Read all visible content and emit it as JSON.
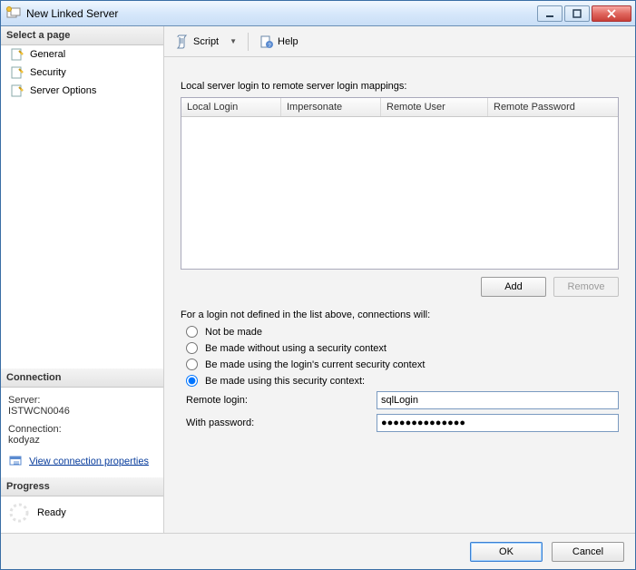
{
  "window": {
    "title": "New Linked Server"
  },
  "sidebar": {
    "select_page": "Select a page",
    "items": [
      {
        "label": "General"
      },
      {
        "label": "Security"
      },
      {
        "label": "Server Options"
      }
    ],
    "connection_header": "Connection",
    "server_label": "Server:",
    "server_value": "ISTWCN0046",
    "connection_label": "Connection:",
    "connection_value": "kodyaz",
    "view_props": "View connection properties",
    "progress_header": "Progress",
    "progress_status": "Ready"
  },
  "toolbar": {
    "script": "Script",
    "help": "Help"
  },
  "content": {
    "mapping_label": "Local server login to remote server login mappings:",
    "columns": {
      "local_login": "Local Login",
      "impersonate": "Impersonate",
      "remote_user": "Remote User",
      "remote_password": "Remote Password"
    },
    "add": "Add",
    "remove": "Remove",
    "not_defined_label": "For a login not defined in the list above, connections will:",
    "radios": {
      "not_made": "Not be made",
      "no_context": "Be made without using a security context",
      "current_context": "Be made using the login's current security context",
      "this_context": "Be made using this security context:"
    },
    "remote_login_label": "Remote login:",
    "remote_login_value": "sqlLogin",
    "with_password_label": "With password:",
    "with_password_value": "●●●●●●●●●●●●●●"
  },
  "footer": {
    "ok": "OK",
    "cancel": "Cancel"
  }
}
